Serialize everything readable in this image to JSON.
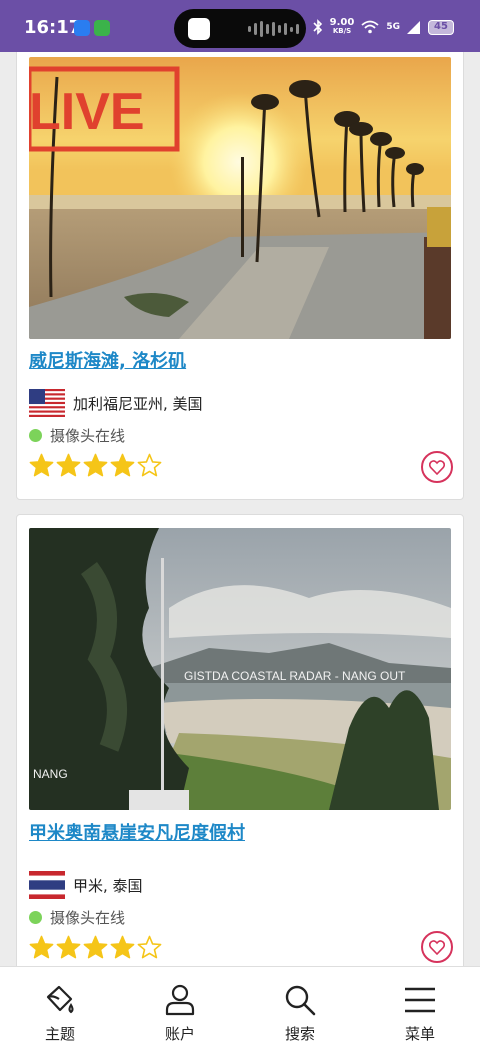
{
  "status_bar": {
    "time": "16:17",
    "speed_value": "9.00",
    "speed_unit": "KB/S",
    "signal_label": "5G",
    "battery": "45"
  },
  "cameras": [
    {
      "title": "威尼斯海滩, 洛杉矶",
      "location": "加利福尼亚州, 美国",
      "country_flag": "us-flag",
      "status": "摄像头在线",
      "status_color": "#7cd35a",
      "rating": 4,
      "rating_max": 5,
      "overlay_text": "LIVE"
    },
    {
      "title": "甲米奥南悬崖安凡尼度假村",
      "location": "甲米, 泰国",
      "country_flag": "th-flag",
      "status": "摄像头在线",
      "status_color": "#7cd35a",
      "rating": 4,
      "rating_max": 5,
      "overlay_text": "GISTDA COASTAL RADAR - NANG OUT",
      "overlay_corner_text": "NANG"
    }
  ],
  "bottom_nav": [
    {
      "label": "主题",
      "icon": "paint-bucket-icon"
    },
    {
      "label": "账户",
      "icon": "user-icon"
    },
    {
      "label": "搜索",
      "icon": "search-icon"
    },
    {
      "label": "菜单",
      "icon": "menu-icon"
    }
  ],
  "colors": {
    "status_bar_bg": "#6b4fa6",
    "link": "#1e88c7",
    "star": "#f5c518",
    "favorite": "#d6335c"
  }
}
